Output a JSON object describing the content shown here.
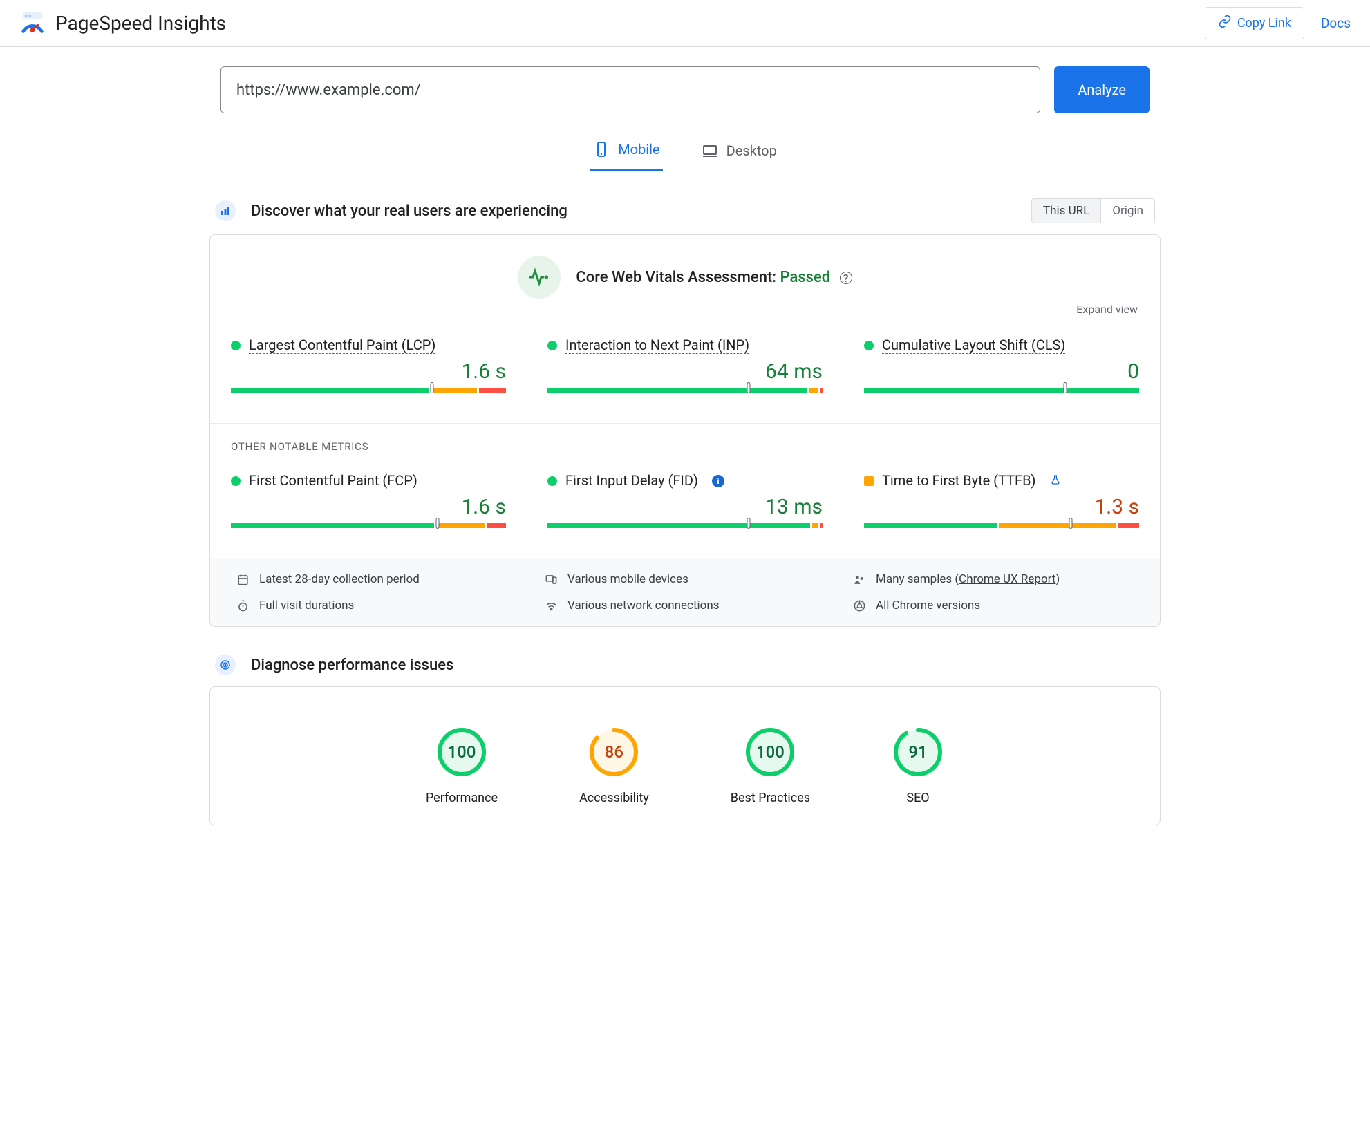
{
  "header": {
    "title": "PageSpeed Insights",
    "copy_link": "Copy Link",
    "docs": "Docs"
  },
  "url_bar": {
    "value": "https://www.example.com/",
    "analyze": "Analyze"
  },
  "tabs": {
    "mobile": "Mobile",
    "desktop": "Desktop",
    "active": "mobile"
  },
  "crux": {
    "section_title": "Discover what your real users are experiencing",
    "scope": {
      "this_url": "This URL",
      "origin": "Origin",
      "active": "this_url"
    },
    "assessment_label": "Core Web Vitals Assessment:",
    "assessment_status": "Passed",
    "expand": "Expand view",
    "other_notable": "OTHER NOTABLE METRICS",
    "metrics_primary": [
      {
        "id": "lcp",
        "name": "Largest Contentful Paint (LCP)",
        "value": "1.6 s",
        "status": "good",
        "dist": {
          "good": 73,
          "avg": 17,
          "poor": 10
        },
        "marker": 73
      },
      {
        "id": "inp",
        "name": "Interaction to Next Paint (INP)",
        "value": "64 ms",
        "status": "good",
        "dist": {
          "good": 96,
          "avg": 3,
          "poor": 1
        },
        "marker": 73
      },
      {
        "id": "cls",
        "name": "Cumulative Layout Shift (CLS)",
        "value": "0",
        "status": "good",
        "dist": {
          "good": 100,
          "avg": 0,
          "poor": 0
        },
        "marker": 73
      }
    ],
    "metrics_secondary": [
      {
        "id": "fcp",
        "name": "First Contentful Paint (FCP)",
        "value": "1.6 s",
        "status": "good",
        "indicator": "green",
        "dist": {
          "good": 75,
          "avg": 18,
          "poor": 7
        },
        "marker": 75
      },
      {
        "id": "fid",
        "name": "First Input Delay (FID)",
        "value": "13 ms",
        "status": "good",
        "indicator": "green",
        "info": true,
        "dist": {
          "good": 97,
          "avg": 2,
          "poor": 1
        },
        "marker": 73
      },
      {
        "id": "ttfb",
        "name": "Time to First Byte (TTFB)",
        "value": "1.3 s",
        "status": "avg",
        "indicator": "orange",
        "flask": true,
        "dist": {
          "good": 49,
          "avg": 43,
          "poor": 8
        },
        "marker": 75
      }
    ],
    "footer": {
      "period": "Latest 28-day collection period",
      "devices": "Various mobile devices",
      "samples_prefix": "Many samples (",
      "samples_link": "Chrome UX Report",
      "samples_suffix": ")",
      "durations": "Full visit durations",
      "network": "Various network connections",
      "browsers": "All Chrome versions"
    }
  },
  "diagnose": {
    "section_title": "Diagnose performance issues",
    "gauges": [
      {
        "id": "performance",
        "label": "Performance",
        "score": 100,
        "color": "green"
      },
      {
        "id": "accessibility",
        "label": "Accessibility",
        "score": 86,
        "color": "orange"
      },
      {
        "id": "best_practices",
        "label": "Best Practices",
        "score": 100,
        "color": "green"
      },
      {
        "id": "seo",
        "label": "SEO",
        "score": 91,
        "color": "green"
      }
    ]
  },
  "colors": {
    "green": "#0cce6b",
    "orange": "#ffa400",
    "green_fill": "#e6f9ef",
    "orange_fill": "#fff7e6",
    "green_text": "#0c6b3d",
    "orange_text": "#c7410d"
  }
}
